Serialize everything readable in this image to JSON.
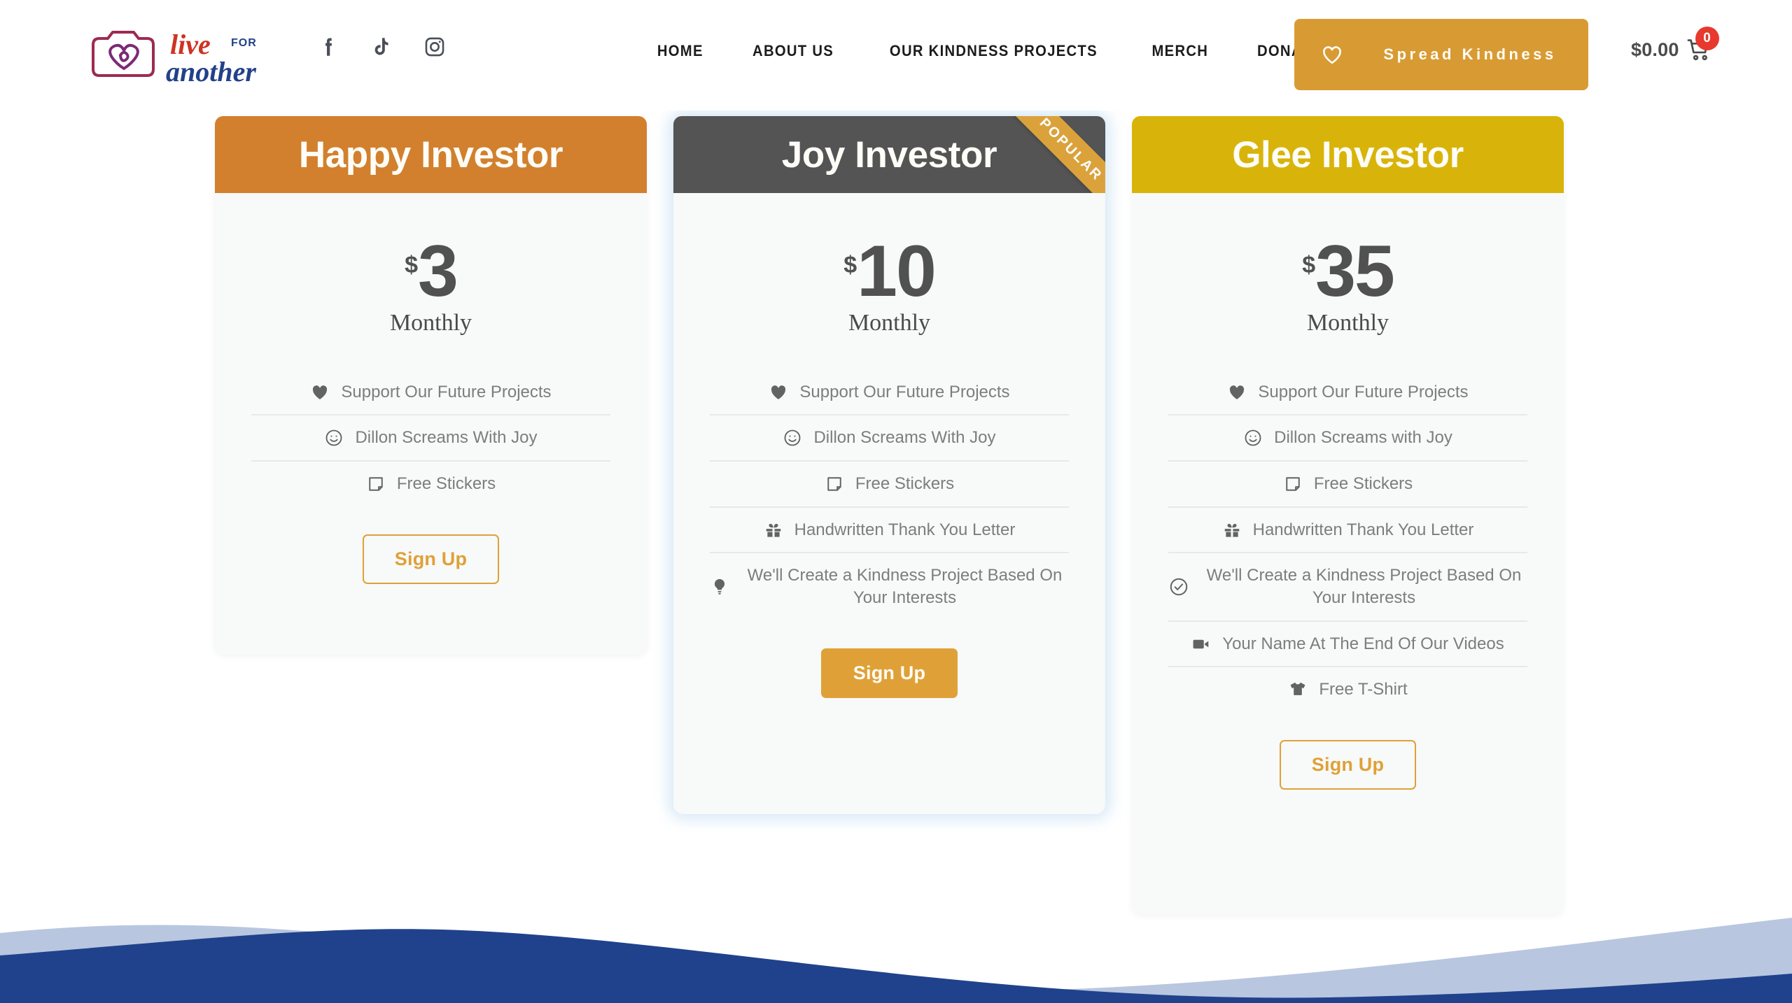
{
  "header": {
    "logo": {
      "word1": "live",
      "word2": "FOR",
      "word3": "another"
    },
    "socials": [
      {
        "name": "facebook-icon",
        "label": "Facebook"
      },
      {
        "name": "tiktok-icon",
        "label": "TikTok"
      },
      {
        "name": "instagram-icon",
        "label": "Instagram"
      }
    ],
    "nav": [
      {
        "label": "HOME"
      },
      {
        "label": "ABOUT US"
      },
      {
        "label": "OUR KINDNESS PROJECTS"
      },
      {
        "label": "MERCH"
      },
      {
        "label": "DONATE"
      }
    ],
    "cta": {
      "label": "Spread Kindness",
      "icon": "heart-outline-icon",
      "color": "#d89b33"
    },
    "cart": {
      "amount": "$0.00",
      "count": "0",
      "badge_color": "#e8392e",
      "icon": "shopping-cart-icon"
    }
  },
  "pricing": {
    "plans": [
      {
        "id": "happy",
        "title": "Happy Investor",
        "header_color": "#d2802e",
        "currency": "$",
        "price": "3",
        "period": "Monthly",
        "popular": false,
        "features": [
          {
            "icon": "heart-filled-icon",
            "text": "Support Our Future Projects"
          },
          {
            "icon": "smiley-icon",
            "text": "Dillon Screams With Joy"
          },
          {
            "icon": "sticker-note-icon",
            "text": "Free Stickers"
          }
        ],
        "button": {
          "label": "Sign Up",
          "style": "outline"
        }
      },
      {
        "id": "joy",
        "title": "Joy Investor",
        "header_color": "#545454",
        "currency": "$",
        "price": "10",
        "period": "Monthly",
        "popular": true,
        "ribbon_label": "POPULAR",
        "features": [
          {
            "icon": "heart-filled-icon",
            "text": "Support Our Future Projects"
          },
          {
            "icon": "smiley-icon",
            "text": "Dillon Screams With Joy"
          },
          {
            "icon": "sticker-note-icon",
            "text": "Free Stickers"
          },
          {
            "icon": "gift-icon",
            "text": "Handwritten Thank You Letter"
          },
          {
            "icon": "lightbulb-icon",
            "text": "We'll Create a Kindness Project Based On Your Interests"
          }
        ],
        "button": {
          "label": "Sign Up",
          "style": "filled"
        }
      },
      {
        "id": "glee",
        "title": "Glee Investor",
        "header_color": "#d8b40b",
        "currency": "$",
        "price": "35",
        "period": "Monthly",
        "popular": false,
        "features": [
          {
            "icon": "heart-filled-icon",
            "text": "Support Our Future Projects"
          },
          {
            "icon": "smiley-icon",
            "text": "Dillon Screams with Joy"
          },
          {
            "icon": "sticker-note-icon",
            "text": "Free Stickers"
          },
          {
            "icon": "gift-icon",
            "text": "Handwritten Thank You Letter"
          },
          {
            "icon": "check-circle-icon",
            "text": "We'll Create a Kindness Project Based On Your Interests"
          },
          {
            "icon": "video-camera-icon",
            "text": "Your Name At The End Of Our Videos"
          },
          {
            "icon": "tshirt-icon",
            "text": "Free T-Shirt"
          }
        ],
        "button": {
          "label": "Sign Up",
          "style": "outline"
        }
      }
    ]
  },
  "footer_wave": {
    "back_color": "#b9c6e0",
    "front_color": "#20428c"
  }
}
